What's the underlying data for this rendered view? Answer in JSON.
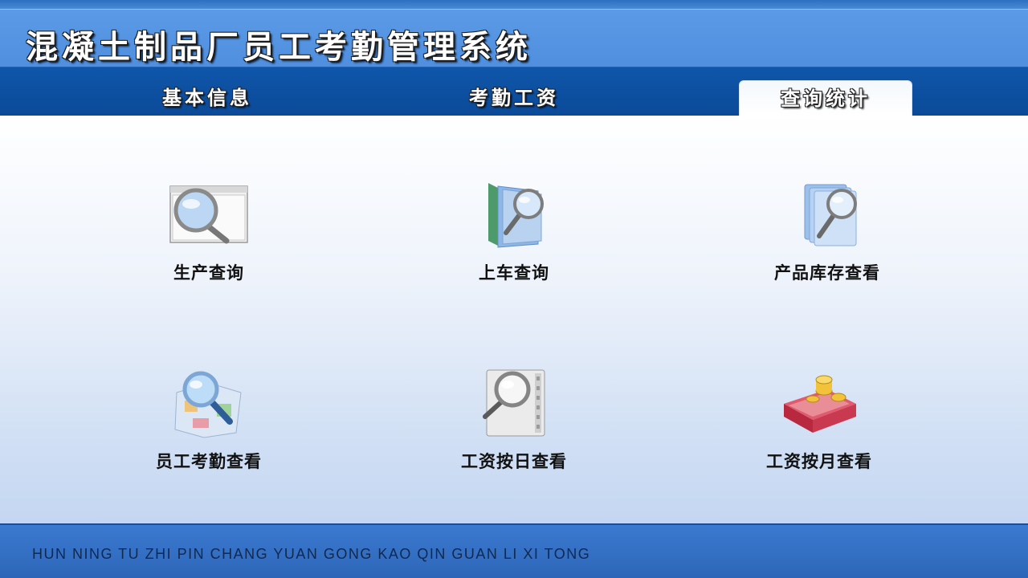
{
  "app": {
    "title": "混凝土制品厂员工考勤管理系统"
  },
  "tabs": [
    {
      "label": "基本信息",
      "active": false
    },
    {
      "label": "考勤工资",
      "active": false
    },
    {
      "label": "查询统计",
      "active": true
    }
  ],
  "functions": [
    {
      "label": "生产查询",
      "icon": "window-magnifier-icon"
    },
    {
      "label": "上车查询",
      "icon": "folder-magnifier-icon"
    },
    {
      "label": "产品库存查看",
      "icon": "documents-magnifier-icon"
    },
    {
      "label": "员工考勤查看",
      "icon": "map-magnifier-icon"
    },
    {
      "label": "工资按日查看",
      "icon": "film-magnifier-icon"
    },
    {
      "label": "工资按月查看",
      "icon": "book-coins-icon"
    }
  ],
  "footer": {
    "text": "HUN NING TU ZHI PIN CHANG YUAN GONG KAO QIN GUAN LI XI TONG"
  },
  "colors": {
    "header_blue": "#4f8fde",
    "tab_bar_blue": "#0b4a98",
    "footer_blue": "#2d66b8",
    "footer_text": "#11284f"
  }
}
